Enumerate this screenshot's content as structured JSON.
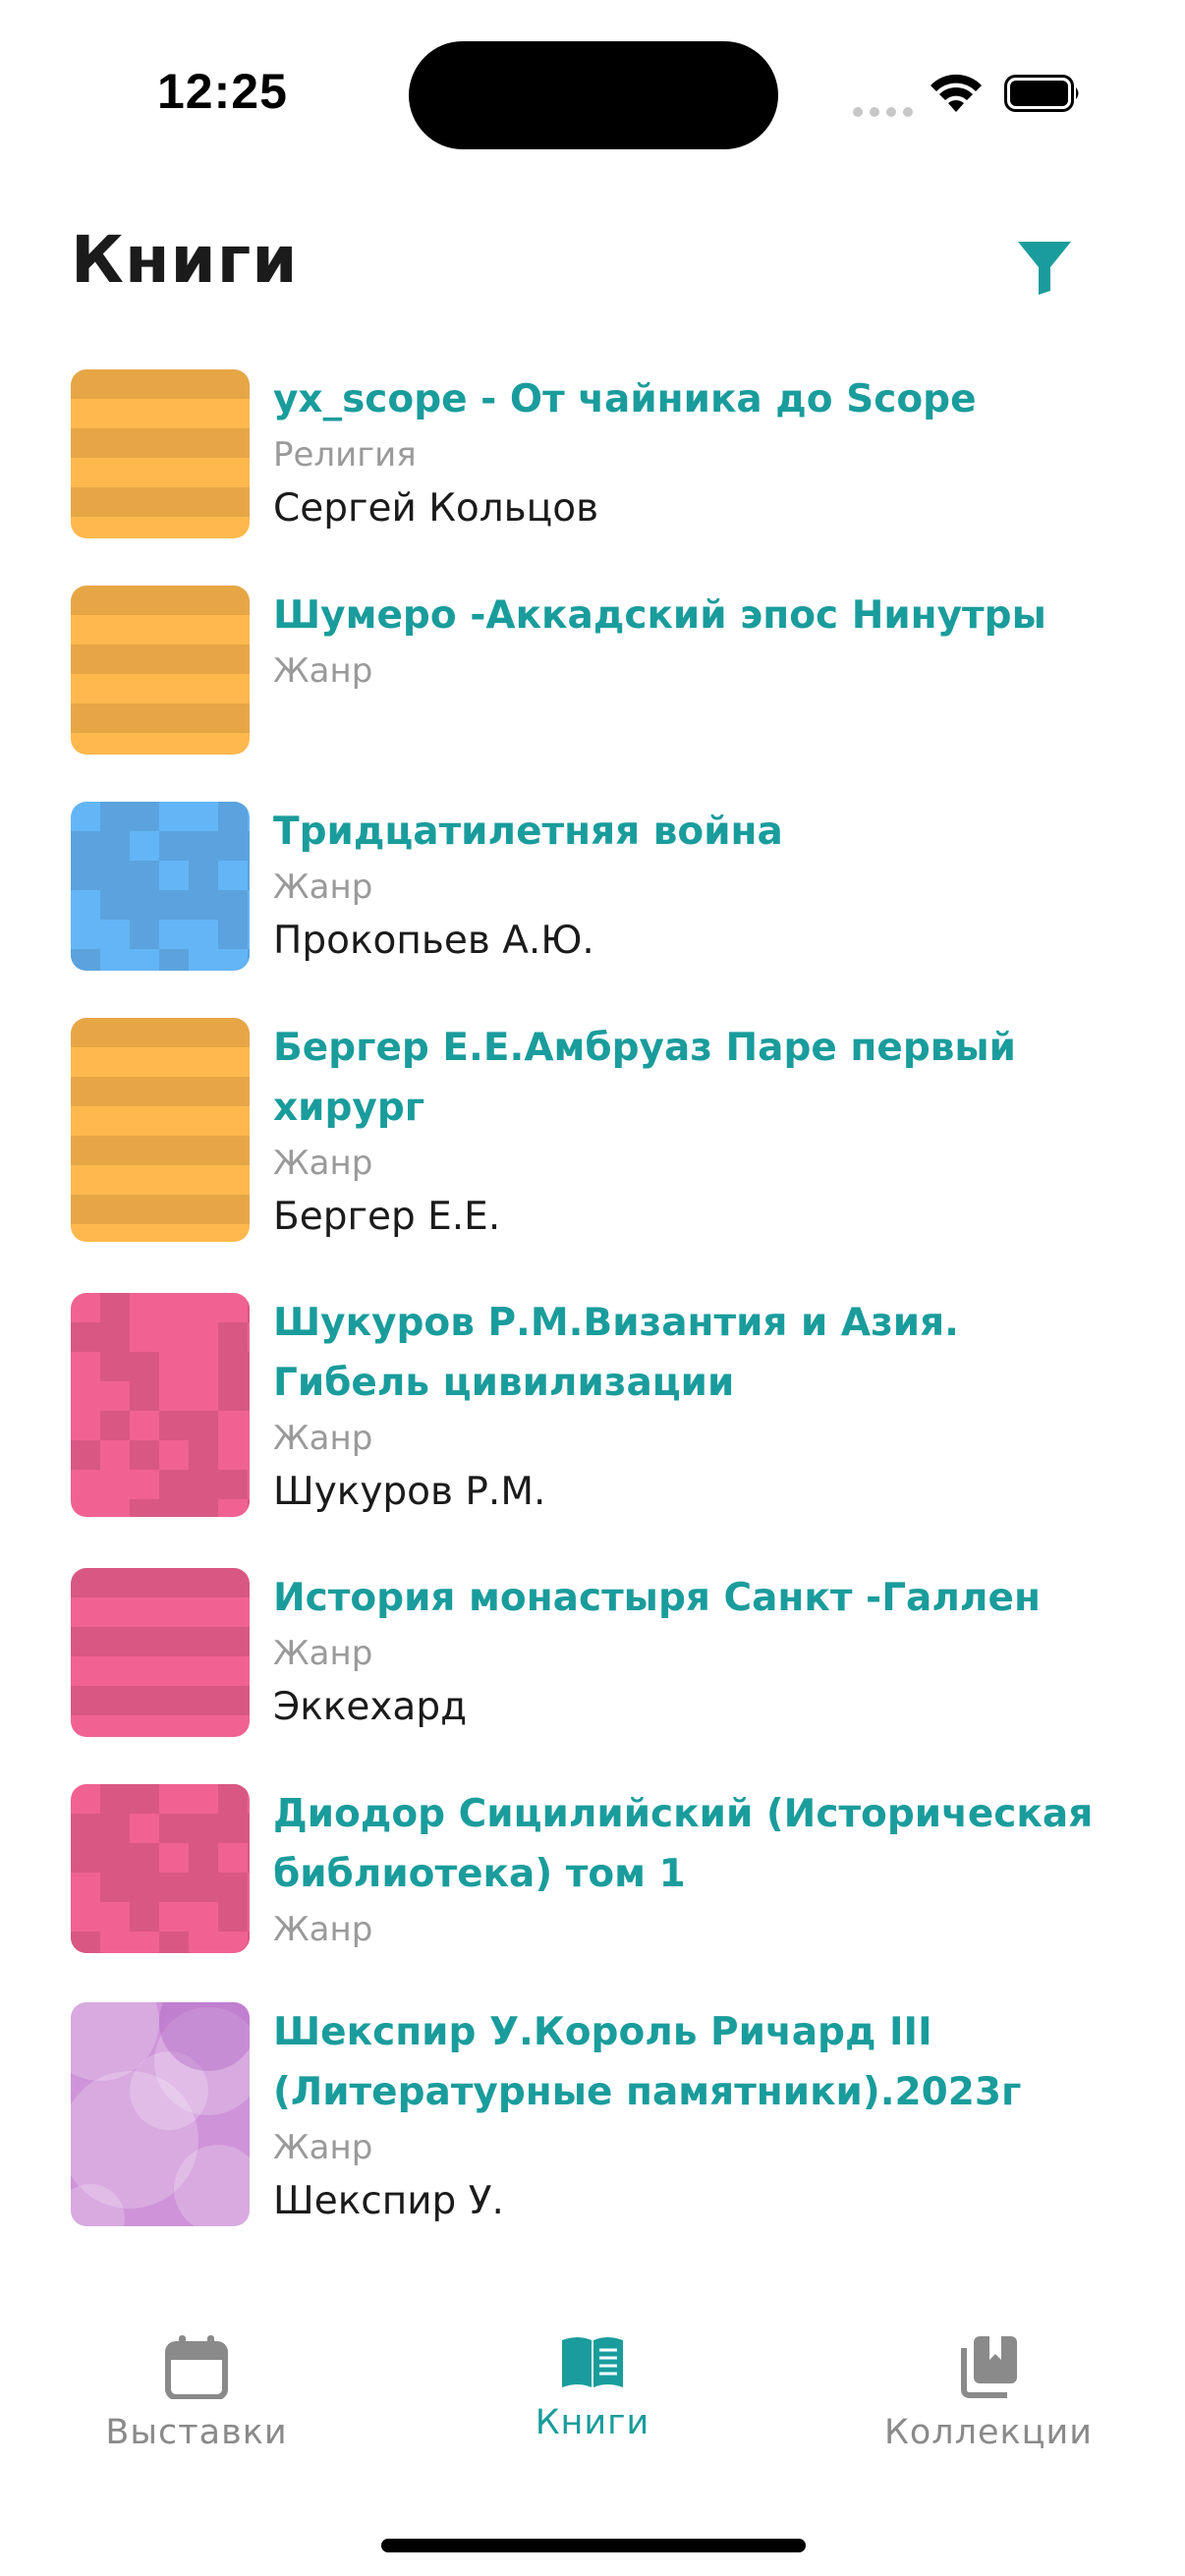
{
  "status_bar": {
    "time": "12:25"
  },
  "header": {
    "title": "Книги"
  },
  "books": [
    {
      "title": "yx_scope - От чайника до Scope",
      "genre": "Религия",
      "author": "Сергей Кольцов",
      "cover": "orange-stripes"
    },
    {
      "title": "Шумеро -Аккадский эпос Нинутры",
      "genre": "Жанр",
      "author": "",
      "cover": "orange-stripes"
    },
    {
      "title": "Тридцатилетняя война",
      "genre": "Жанр",
      "author": "Прокопьев А.Ю.",
      "cover": "blue-blocks"
    },
    {
      "title": "Бергер Е.Е.Амбруаз Паре первый хирург",
      "genre": "Жанр",
      "author": "Бергер Е.Е.",
      "cover": "orange-stripes"
    },
    {
      "title": "Шукуров Р.М.Византия и Азия. Гибель цивилизации",
      "genre": "Жанр",
      "author": "Шукуров Р.М.",
      "cover": "pink-blocks"
    },
    {
      "title": "История монастыря Санкт -Галлен",
      "genre": "Жанр",
      "author": "Эккехард",
      "cover": "pink-stripes"
    },
    {
      "title": "Диодор Сицилийский (Историческая библиотека) том 1",
      "genre": "Жанр",
      "author": "",
      "cover": "pink-blocks"
    },
    {
      "title": "Шекспир У.Король Ричард III (Литературные памятники).2023г",
      "genre": "Жанр",
      "author": "Шекспир У.",
      "cover": "purple-bubbles"
    }
  ],
  "tabs": [
    {
      "label": "Выставки",
      "icon": "calendar-icon",
      "active": false
    },
    {
      "label": "Книги",
      "icon": "open-book-icon",
      "active": true
    },
    {
      "label": "Коллекции",
      "icon": "collection-icon",
      "active": false
    }
  ],
  "colors": {
    "accent": "#1a9c9c",
    "orange": "#ffb84d",
    "orange_dark": "#e6a646",
    "blue": "#64b5f6",
    "blue_dark": "#5aa3de",
    "pink": "#f06292",
    "pink_dark": "#d85883",
    "purple": "#ce93d8"
  }
}
